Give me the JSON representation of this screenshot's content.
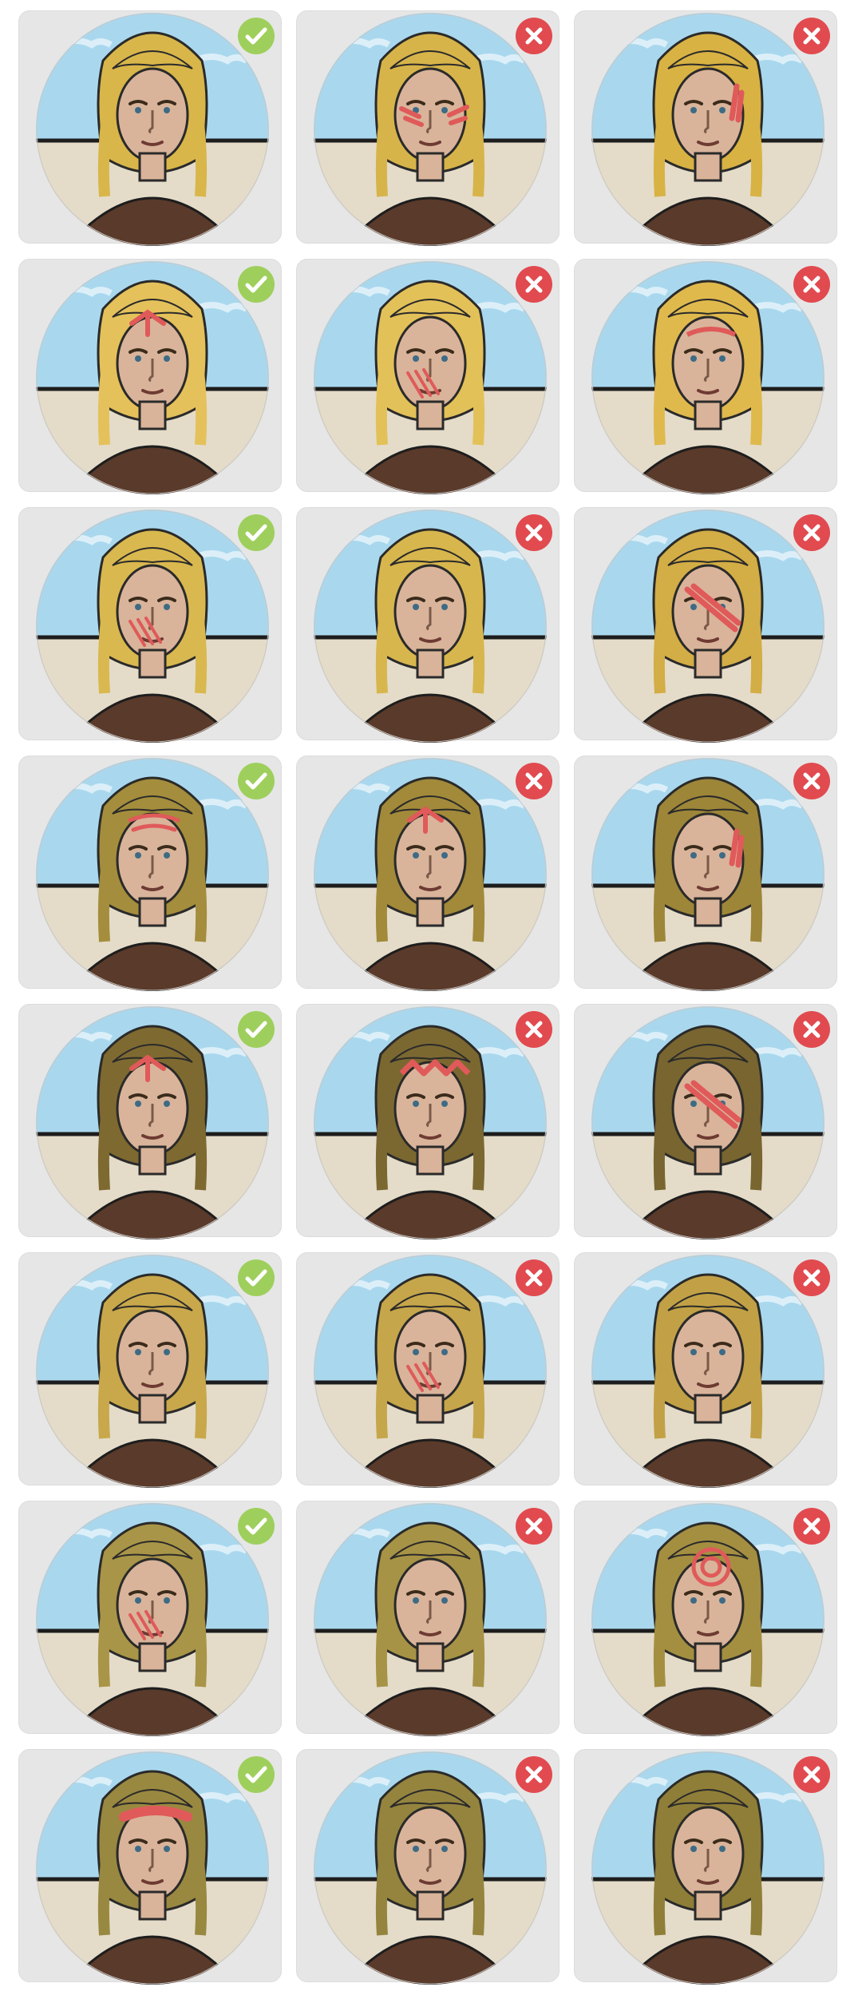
{
  "colors": {
    "card_bg": "#e6e6e6",
    "sky": "#a9d8ee",
    "wall": "#e4dcc9",
    "tunic": "#5a3a2a",
    "skin": "#d9b49a",
    "hair": "#d8b64a",
    "paint": "#e05a5a",
    "accept": "#9ecf5c",
    "reject": "#e14a4f"
  },
  "grid": {
    "cards": [
      {
        "status": "accepted",
        "icon": "check-icon",
        "hair": "#d8b64a",
        "paint": "none"
      },
      {
        "status": "rejected",
        "icon": "x-icon",
        "hair": "#d7b44a",
        "paint": "cheeks"
      },
      {
        "status": "rejected",
        "icon": "x-icon",
        "hair": "#d8b243",
        "paint": "eye-streak"
      },
      {
        "status": "accepted",
        "icon": "check-icon",
        "hair": "#e4c15a",
        "paint": "forehead"
      },
      {
        "status": "rejected",
        "icon": "x-icon",
        "hair": "#e3c159",
        "paint": "cheek-lines"
      },
      {
        "status": "rejected",
        "icon": "x-icon",
        "hair": "#e0b94d",
        "paint": "brow"
      },
      {
        "status": "accepted",
        "icon": "check-icon",
        "hair": "#d9b84f",
        "paint": "cheek-lines"
      },
      {
        "status": "rejected",
        "icon": "x-icon",
        "hair": "#d7b64d",
        "paint": "none"
      },
      {
        "status": "rejected",
        "icon": "x-icon",
        "hair": "#d3ad45",
        "paint": "diagonal"
      },
      {
        "status": "accepted",
        "icon": "check-icon",
        "hair": "#a48d3c",
        "paint": "forehead-bands"
      },
      {
        "status": "rejected",
        "icon": "x-icon",
        "hair": "#a28a3a",
        "paint": "forehead"
      },
      {
        "status": "rejected",
        "icon": "x-icon",
        "hair": "#9d8638",
        "paint": "eye-streak"
      },
      {
        "status": "accepted",
        "icon": "check-icon",
        "hair": "#7e6a31",
        "paint": "forehead"
      },
      {
        "status": "rejected",
        "icon": "x-icon",
        "hair": "#7b6831",
        "paint": "zigzag"
      },
      {
        "status": "rejected",
        "icon": "x-icon",
        "hair": "#786530",
        "paint": "diagonal"
      },
      {
        "status": "accepted",
        "icon": "check-icon",
        "hair": "#c8a84b",
        "paint": "none"
      },
      {
        "status": "rejected",
        "icon": "x-icon",
        "hair": "#c6a64a",
        "paint": "cheek-lines"
      },
      {
        "status": "rejected",
        "icon": "x-icon",
        "hair": "#c2a146",
        "paint": "none"
      },
      {
        "status": "accepted",
        "icon": "check-icon",
        "hair": "#a99547",
        "paint": "cheek-lines"
      },
      {
        "status": "rejected",
        "icon": "x-icon",
        "hair": "#a79345",
        "paint": "none"
      },
      {
        "status": "rejected",
        "icon": "x-icon",
        "hair": "#a48f41",
        "paint": "spiral"
      },
      {
        "status": "accepted",
        "icon": "check-icon",
        "hair": "#998840",
        "paint": "forehead-band"
      },
      {
        "status": "rejected",
        "icon": "x-icon",
        "hair": "#94843e",
        "paint": "none"
      },
      {
        "status": "rejected",
        "icon": "x-icon",
        "hair": "#8f7e37",
        "paint": "none"
      }
    ]
  }
}
